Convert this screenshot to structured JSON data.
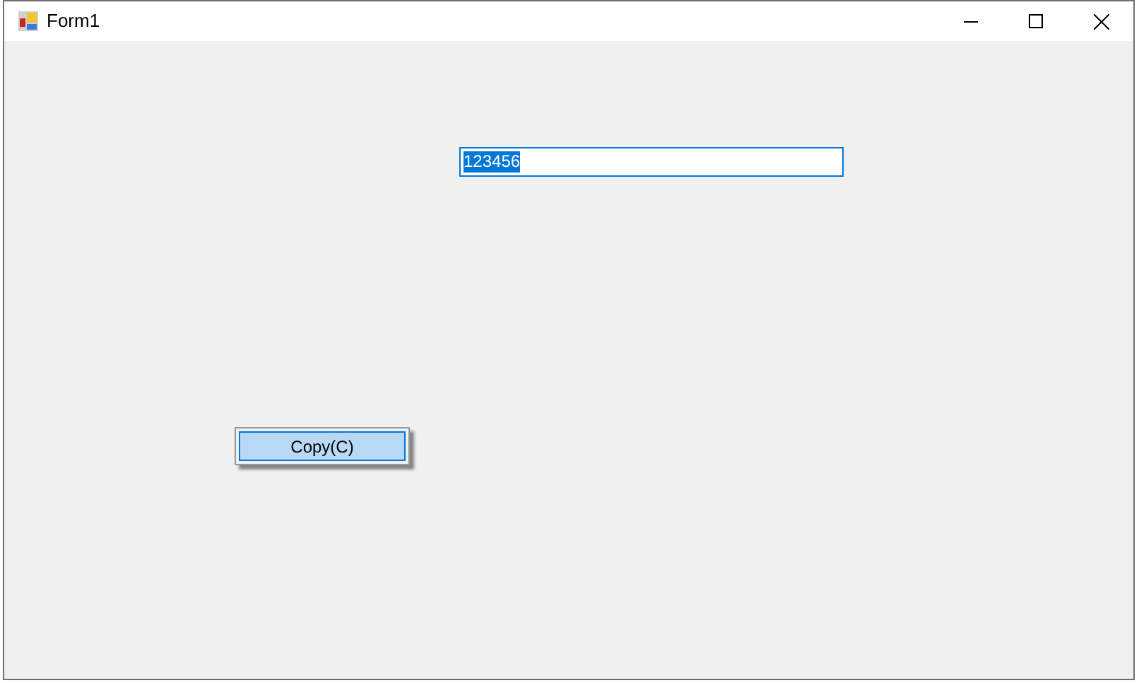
{
  "window": {
    "title": "Form1"
  },
  "textbox": {
    "value": "123456",
    "text_selected": true,
    "focused": true
  },
  "context_menu": {
    "items": [
      {
        "label": "Copy(C)",
        "selected": true
      }
    ]
  }
}
